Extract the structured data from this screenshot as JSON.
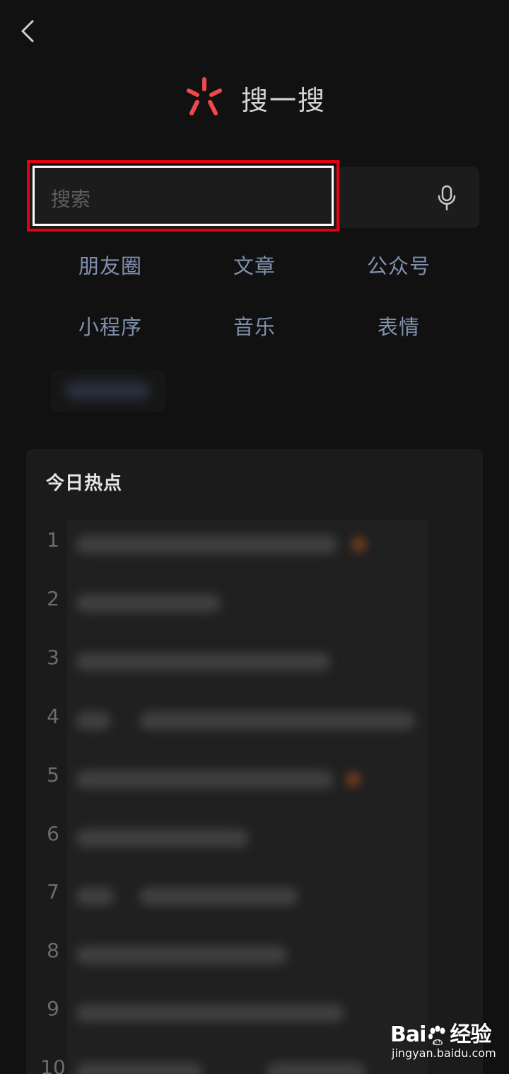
{
  "header": {
    "title": "搜一搜",
    "logo_icon": "search-spark-logo",
    "logo_color": "#f0494b"
  },
  "nav": {
    "back_icon": "chevron-left-icon"
  },
  "search": {
    "placeholder": "搜索",
    "value": "",
    "mic_icon": "microphone-icon",
    "highlight_color": "#e60012"
  },
  "categories": [
    {
      "label": "朋友圈"
    },
    {
      "label": "文章"
    },
    {
      "label": "公众号"
    },
    {
      "label": "小程序"
    },
    {
      "label": "音乐"
    },
    {
      "label": "表情"
    }
  ],
  "hot": {
    "title": "今日热点",
    "items": [
      {
        "rank": "1"
      },
      {
        "rank": "2"
      },
      {
        "rank": "3"
      },
      {
        "rank": "4"
      },
      {
        "rank": "5"
      },
      {
        "rank": "6"
      },
      {
        "rank": "7"
      },
      {
        "rank": "8"
      },
      {
        "rank": "9"
      },
      {
        "rank": "10"
      }
    ]
  },
  "watermark": {
    "brand_part1": "Bai",
    "brand_part2": "经验",
    "url": "jingyan.baidu.com"
  },
  "colors": {
    "background": "#111111",
    "category_text": "#8090ac",
    "card": "#1b1b1b"
  }
}
